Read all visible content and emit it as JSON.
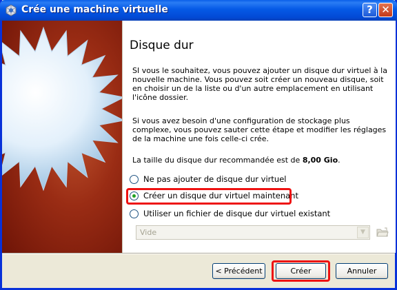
{
  "window": {
    "title": "Crée une machine virtuelle",
    "help_label": "?",
    "close_label": "✕"
  },
  "page": {
    "title": "Disque dur",
    "paragraph1": "SI vous le souhaitez, vous pouvez ajouter un disque dur virtuel à la nouvelle machine. Vous pouvez soit créer un nouveau disque, soit en choisir un de la liste ou d'un autre emplacement en utilisant l'icône dossier.",
    "paragraph2": "Si vous avez besoin d'une configuration de stockage plus complexe, vous pouvez sauter cette étape et modifier les réglages de la machine une fois celle-ci crée.",
    "size_text_prefix": "La taille du disque dur recommandée est de ",
    "size_value": "8,00 Gio",
    "size_text_suffix": "."
  },
  "options": [
    {
      "label": "Ne pas ajouter de disque dur virtuel",
      "selected": false
    },
    {
      "label": "Créer un disque dur virtuel maintenant",
      "selected": true
    },
    {
      "label": "Utiliser un fichier de disque dur virtuel existant",
      "selected": false
    }
  ],
  "disk_select": {
    "value": "Vide",
    "enabled": false
  },
  "buttons": {
    "previous": "< Précédent",
    "create": "Créer",
    "cancel": "Annuler"
  },
  "colors": {
    "titlebar": "#0559e6",
    "highlight": "#ee1111",
    "side_panel": "#9a2c14"
  },
  "icons": {
    "title": "virtualbox-icon",
    "folder": "folder-icon",
    "combo_arrow": "chevron-down-icon"
  }
}
